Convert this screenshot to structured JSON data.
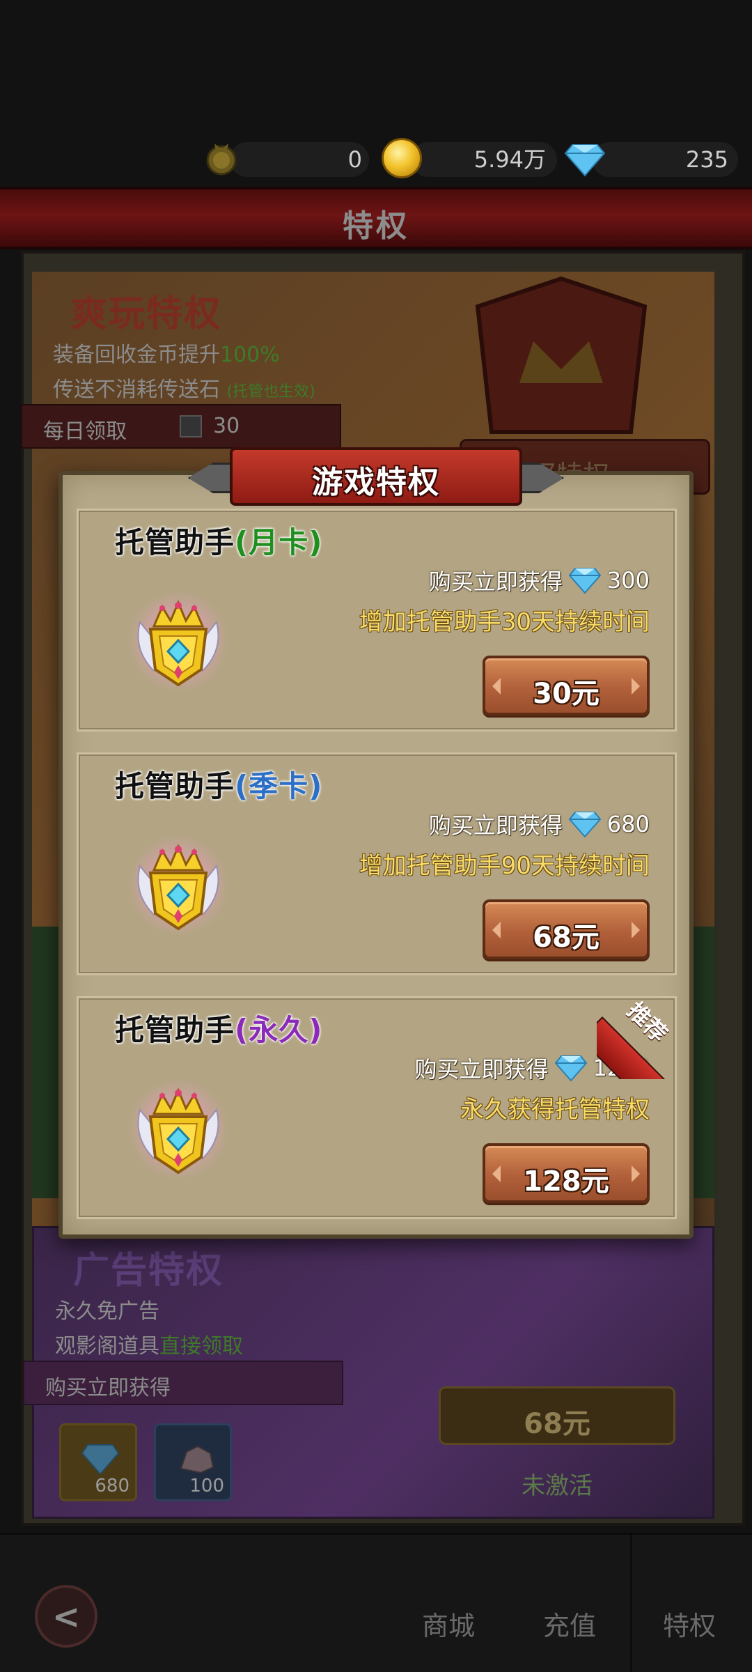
{
  "resources": {
    "medal_count": "0",
    "gold": "5.94万",
    "gems": "235"
  },
  "page_title": "特权",
  "background": {
    "card1": {
      "title": "爽玩特权",
      "line1_prefix": "装备回收金币提升",
      "line1_value": "100%",
      "line2": "传送不消耗传送石",
      "line2_note": "(托管也生效)",
      "daily_label": "每日领取",
      "daily_value": "30",
      "buy_button": "购买特权"
    },
    "card2": {
      "title": "广告特权",
      "line1": "永久免广告",
      "line2_prefix": "观影阁道具",
      "line2_value": "直接领取",
      "ribbon_label": "购买立即获得",
      "items": [
        {
          "icon": "diamond-icon",
          "count": "680"
        },
        {
          "icon": "ore-icon",
          "count": "100"
        }
      ],
      "price": "68元",
      "status": "未激活"
    }
  },
  "modal": {
    "title": "游戏特权",
    "cards": [
      {
        "title": "托管助手",
        "tag": "(月卡)",
        "tag_color": "#1f8f1f",
        "gain_label": "购买立即获得",
        "gain_value": "300",
        "desc": "增加托管助手30天持续时间",
        "price": "30元",
        "recommended": false
      },
      {
        "title": "托管助手",
        "tag": "(季卡)",
        "tag_color": "#2c6fc7",
        "gain_label": "购买立即获得",
        "gain_value": "680",
        "desc": "增加托管助手90天持续时间",
        "price": "68元",
        "recommended": false
      },
      {
        "title": "托管助手",
        "tag": "(永久)",
        "tag_color": "#8a2ab8",
        "gain_label": "购买立即获得",
        "gain_value": "1280",
        "desc": "永久获得托管特权",
        "price": "128元",
        "recommended": true,
        "recommended_label": "推荐"
      }
    ]
  },
  "bottom_nav": {
    "back": "<",
    "tabs": [
      "商城",
      "充值",
      "特权"
    ],
    "active_tab": "特权"
  }
}
